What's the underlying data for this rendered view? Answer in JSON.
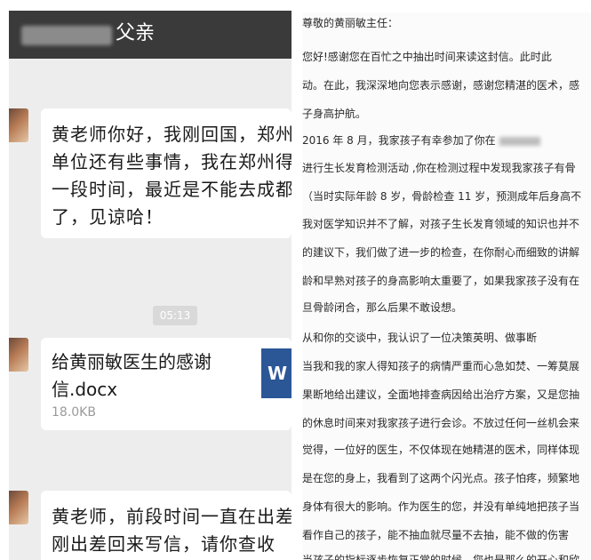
{
  "chat": {
    "title": "父亲",
    "messages": [
      {
        "type": "text",
        "text": "黄老师你好，我刚回国，郑州\n单位还有些事情，我在郑州得\n一段时间，最近是不能去成都\n了，见谅哈！"
      },
      {
        "type": "timestamp",
        "text": "05:13"
      },
      {
        "type": "file",
        "name": "给黄丽敏医生的感谢\n信.docx",
        "size": "18.0KB",
        "icon": "word-doc-icon",
        "icon_label": "W"
      },
      {
        "type": "text",
        "text": "黄老师，前段时间一直在出差\n刚出差回来写信，请你查收"
      }
    ]
  },
  "letter": {
    "lines": [
      "尊敬的黄丽敏主任：",
      "    您好!感谢您在百忙之中抽出时间来读这封信。此时此",
      "动。在此，我深深地向您表示感谢，感谢您精湛的医术，感",
      "子身高护航。",
      "    2016 年 8 月，我家孩子有幸参加了你在",
      "进行生长发育检测活动 ,你在检测过程中发现我家孩子有骨",
      "（当时实际年龄 8 岁，骨龄检查 11 岁，预测成年后身高不",
      "我对医学知识并不了解，对孩子生长发育领域的知识也并不",
      "的建议下，我们做了进一步的检查，在你耐心而细致的讲解",
      "龄和早熟对孩子的身高影响太重要了，如果我家孩子没有在",
      "旦骨龄闭合，那么后果不敢设想。",
      "    从和你的交谈中，我认识了一位决策英明、做事断",
      "当我和我的家人得知孩子的病情严重而心急如焚、一筹莫展",
      "果断地给出建议，全面地排查病因给出治疗方案，又是您抽",
      "的休息时间来对我家孩子进行会诊。不放过任何一丝机会来",
      "觉得，一位好的医生，不仅体现在她精湛的医术，同样体现",
      "是在您的身上，我看到了这两个闪光点。孩子怕疼，频繁地",
      "身体有很大的影响。作为医生的您，并没有单纯地把孩子当",
      "看作自己的孩子，能不抽血就尽量不去抽，能不做的伤害",
      "当孩子的指标逐步恢复正常的时候，您也是那么的开心和欣"
    ]
  }
}
